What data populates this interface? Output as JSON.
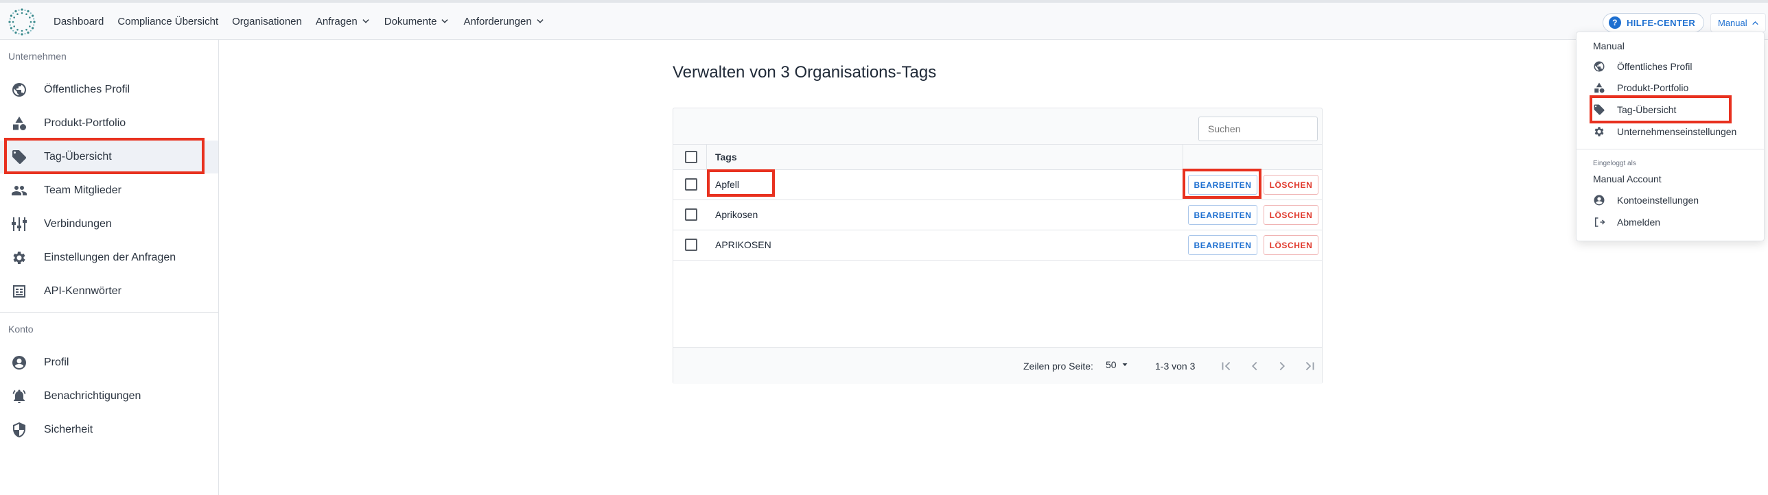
{
  "topbar": {
    "nav": [
      {
        "label": "Dashboard",
        "dropdown": false
      },
      {
        "label": "Compliance Übersicht",
        "dropdown": false
      },
      {
        "label": "Organisationen",
        "dropdown": false
      },
      {
        "label": "Anfragen",
        "dropdown": true
      },
      {
        "label": "Dokumente",
        "dropdown": true
      },
      {
        "label": "Anforderungen",
        "dropdown": true
      }
    ],
    "help_label": "HILFE-CENTER",
    "user_label": "Manual"
  },
  "sidebar": {
    "section_company": "Unternehmen",
    "company_items": [
      {
        "label": "Öffentliches Profil",
        "icon": "globe-icon"
      },
      {
        "label": "Produkt-Portfolio",
        "icon": "shapes-icon"
      },
      {
        "label": "Tag-Übersicht",
        "icon": "tag-icon",
        "active": true
      },
      {
        "label": "Team Mitglieder",
        "icon": "people-icon"
      },
      {
        "label": "Verbindungen",
        "icon": "connections-icon"
      },
      {
        "label": "Einstellungen der Anfragen",
        "icon": "gear-icon"
      },
      {
        "label": "API-Kennwörter",
        "icon": "api-key-icon"
      }
    ],
    "section_account": "Konto",
    "account_items": [
      {
        "label": "Profil",
        "icon": "account-circle-icon"
      },
      {
        "label": "Benachrichtigungen",
        "icon": "bell-icon"
      },
      {
        "label": "Sicherheit",
        "icon": "shield-icon"
      }
    ]
  },
  "main": {
    "title": "Verwalten von 3 Organisations-Tags",
    "search_placeholder": "Suchen",
    "column_header": "Tags",
    "rows": [
      {
        "tag": "Apfell",
        "edit": "BEARBEITEN",
        "delete": "LÖSCHEN"
      },
      {
        "tag": "Aprikosen",
        "edit": "BEARBEITEN",
        "delete": "LÖSCHEN"
      },
      {
        "tag": "APRIKOSEN",
        "edit": "BEARBEITEN",
        "delete": "LÖSCHEN"
      }
    ],
    "footer": {
      "rows_per_page_label": "Zeilen pro Seite:",
      "rows_per_page_value": "50",
      "range": "1-3 von 3"
    }
  },
  "user_menu": {
    "heading": "Manual",
    "items": [
      {
        "label": "Öffentliches Profil",
        "icon": "globe-icon"
      },
      {
        "label": "Produkt-Portfolio",
        "icon": "shapes-icon"
      },
      {
        "label": "Tag-Übersicht",
        "icon": "tag-icon"
      },
      {
        "label": "Unternehmenseinstellungen",
        "icon": "gear-icon"
      }
    ],
    "logged_in_as_label": "Eingeloggt als",
    "account_name": "Manual Account",
    "account_items": [
      {
        "label": "Kontoeinstellungen",
        "icon": "account-circle-icon"
      },
      {
        "label": "Abmelden",
        "icon": "logout-icon"
      }
    ]
  },
  "colors": {
    "accent": "#1d6fd0",
    "danger": "#e0382b",
    "highlight": "#e8311f"
  }
}
